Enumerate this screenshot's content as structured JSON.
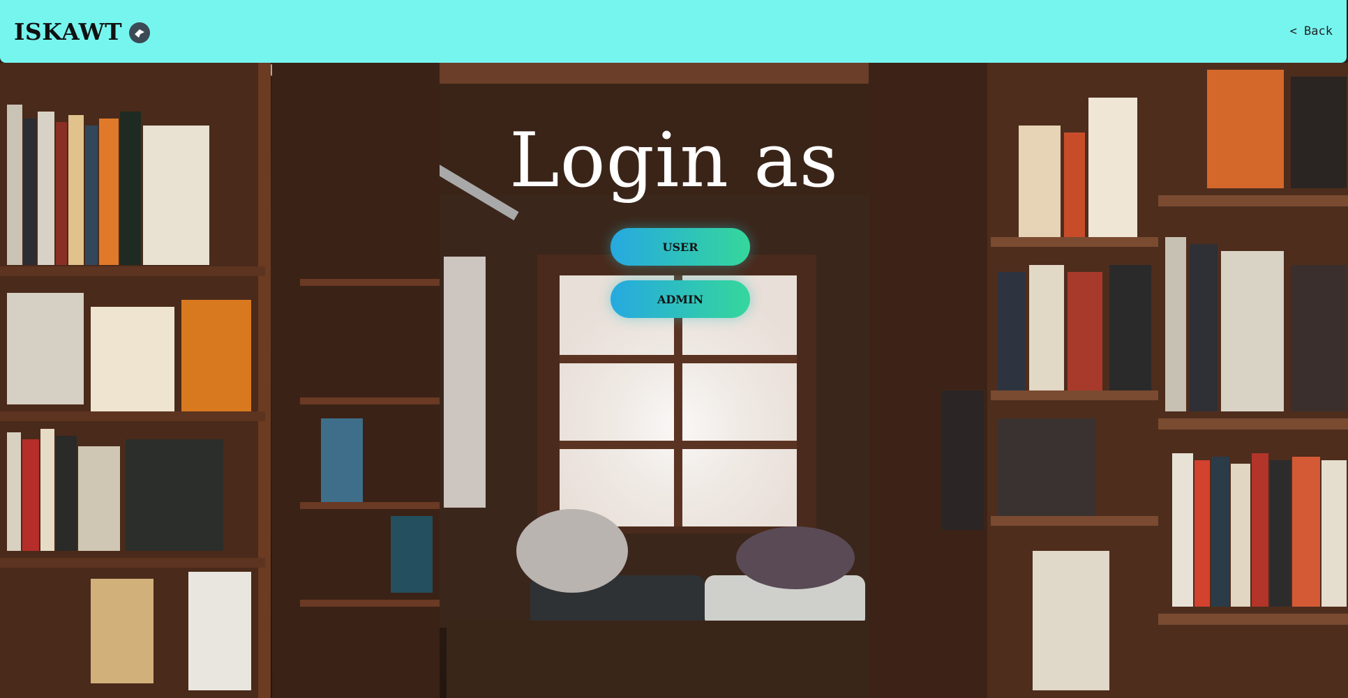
{
  "header": {
    "brand": "ISKAWT",
    "logo_icon": "stingray-logo-icon",
    "back_label": "< Back",
    "background": "#76f5ef"
  },
  "login": {
    "title": "Login as",
    "roles": [
      {
        "label": "USER"
      },
      {
        "label": "ADMIN"
      }
    ],
    "button_gradient": [
      "#26a9e0",
      "#35d79b"
    ]
  },
  "background": {
    "description_icon": "bookstore-background-image"
  }
}
